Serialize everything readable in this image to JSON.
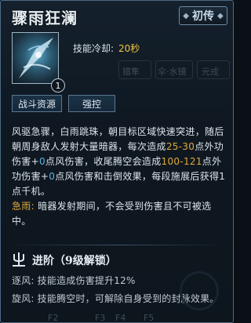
{
  "skill": {
    "title": "骤雨狂澜",
    "tag": "初传",
    "level": "1",
    "cooldown_label": "技能冷却:",
    "cooldown_value": "20秒"
  },
  "background_ghost": {
    "labels": [
      "猎隼",
      "伞·水镜",
      "元戎"
    ],
    "bottom_hints": [
      "F2",
      "F3",
      "F4",
      "F5"
    ]
  },
  "buttons": {
    "battle_resource": "战斗资源",
    "control": "强控"
  },
  "description": {
    "p1_a": "风驱急骤，白雨跳珠，朝目标区域快速突进，随后朝周身敌人发射大量暗器，每次造成",
    "p1_b": "25-30",
    "p1_c": "点外功伤害+",
    "p1_d": "0",
    "p1_e": "点风伤害，收尾腾空会造成",
    "p1_f": "100-121",
    "p1_g": "点外功伤害+",
    "p1_h": "0",
    "p1_i": "点风伤害和击倒效果，每段施展后获得1点千机。",
    "p2_label": "急雨:",
    "p2_text": " 暗器发射期间，不会受到伤害且不可被选中。"
  },
  "advance": {
    "title": "进阶（9级解锁）",
    "lines": [
      {
        "label": "逐风:",
        "text": " 技能造成伤害提升12%"
      },
      {
        "label": "旋风:",
        "text": " 技能腾空时，可解除自身受到的封脉效果。"
      }
    ]
  },
  "colors": {
    "accent_orange": "#e0a93a",
    "accent_blue": "#5ab3e6",
    "cooldown_gold": "#f0c243"
  },
  "icons": {
    "tag": "diamond-icon",
    "skill": "wind-blade-skill-icon",
    "advance": "trident-icon"
  }
}
